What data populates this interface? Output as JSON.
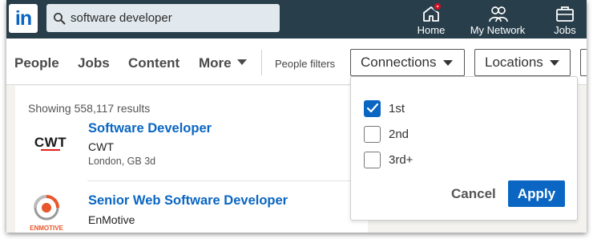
{
  "app": {
    "logo_text": "in"
  },
  "search": {
    "value": "software developer",
    "icon": "search-icon"
  },
  "topnav": {
    "items": [
      {
        "label": "Home",
        "icon": "home-icon",
        "has_badge": true
      },
      {
        "label": "My Network",
        "icon": "network-icon"
      },
      {
        "label": "Jobs",
        "icon": "briefcase-icon"
      }
    ]
  },
  "filterbar": {
    "tabs": [
      "People",
      "Jobs",
      "Content",
      "More"
    ],
    "people_filters_label": "People filters",
    "connections_label": "Connections",
    "locations_label": "Locations"
  },
  "results": {
    "count_text": "Showing 558,117 results",
    "jobs": [
      {
        "title": "Software Developer",
        "company": "CWT",
        "meta": "London, GB 3d",
        "logo_text": "CWT"
      },
      {
        "title": "Senior Web Software Developer",
        "company": "EnMotive",
        "logo_text": "ENMOTIVE"
      }
    ]
  },
  "connections_dropdown": {
    "options": [
      {
        "label": "1st",
        "checked": true
      },
      {
        "label": "2nd",
        "checked": false
      },
      {
        "label": "3rd+",
        "checked": false
      }
    ],
    "cancel_label": "Cancel",
    "apply_label": "Apply"
  },
  "colors": {
    "nav_bg": "#283e4a",
    "accent": "#0a66c2",
    "badge": "#d11124"
  }
}
